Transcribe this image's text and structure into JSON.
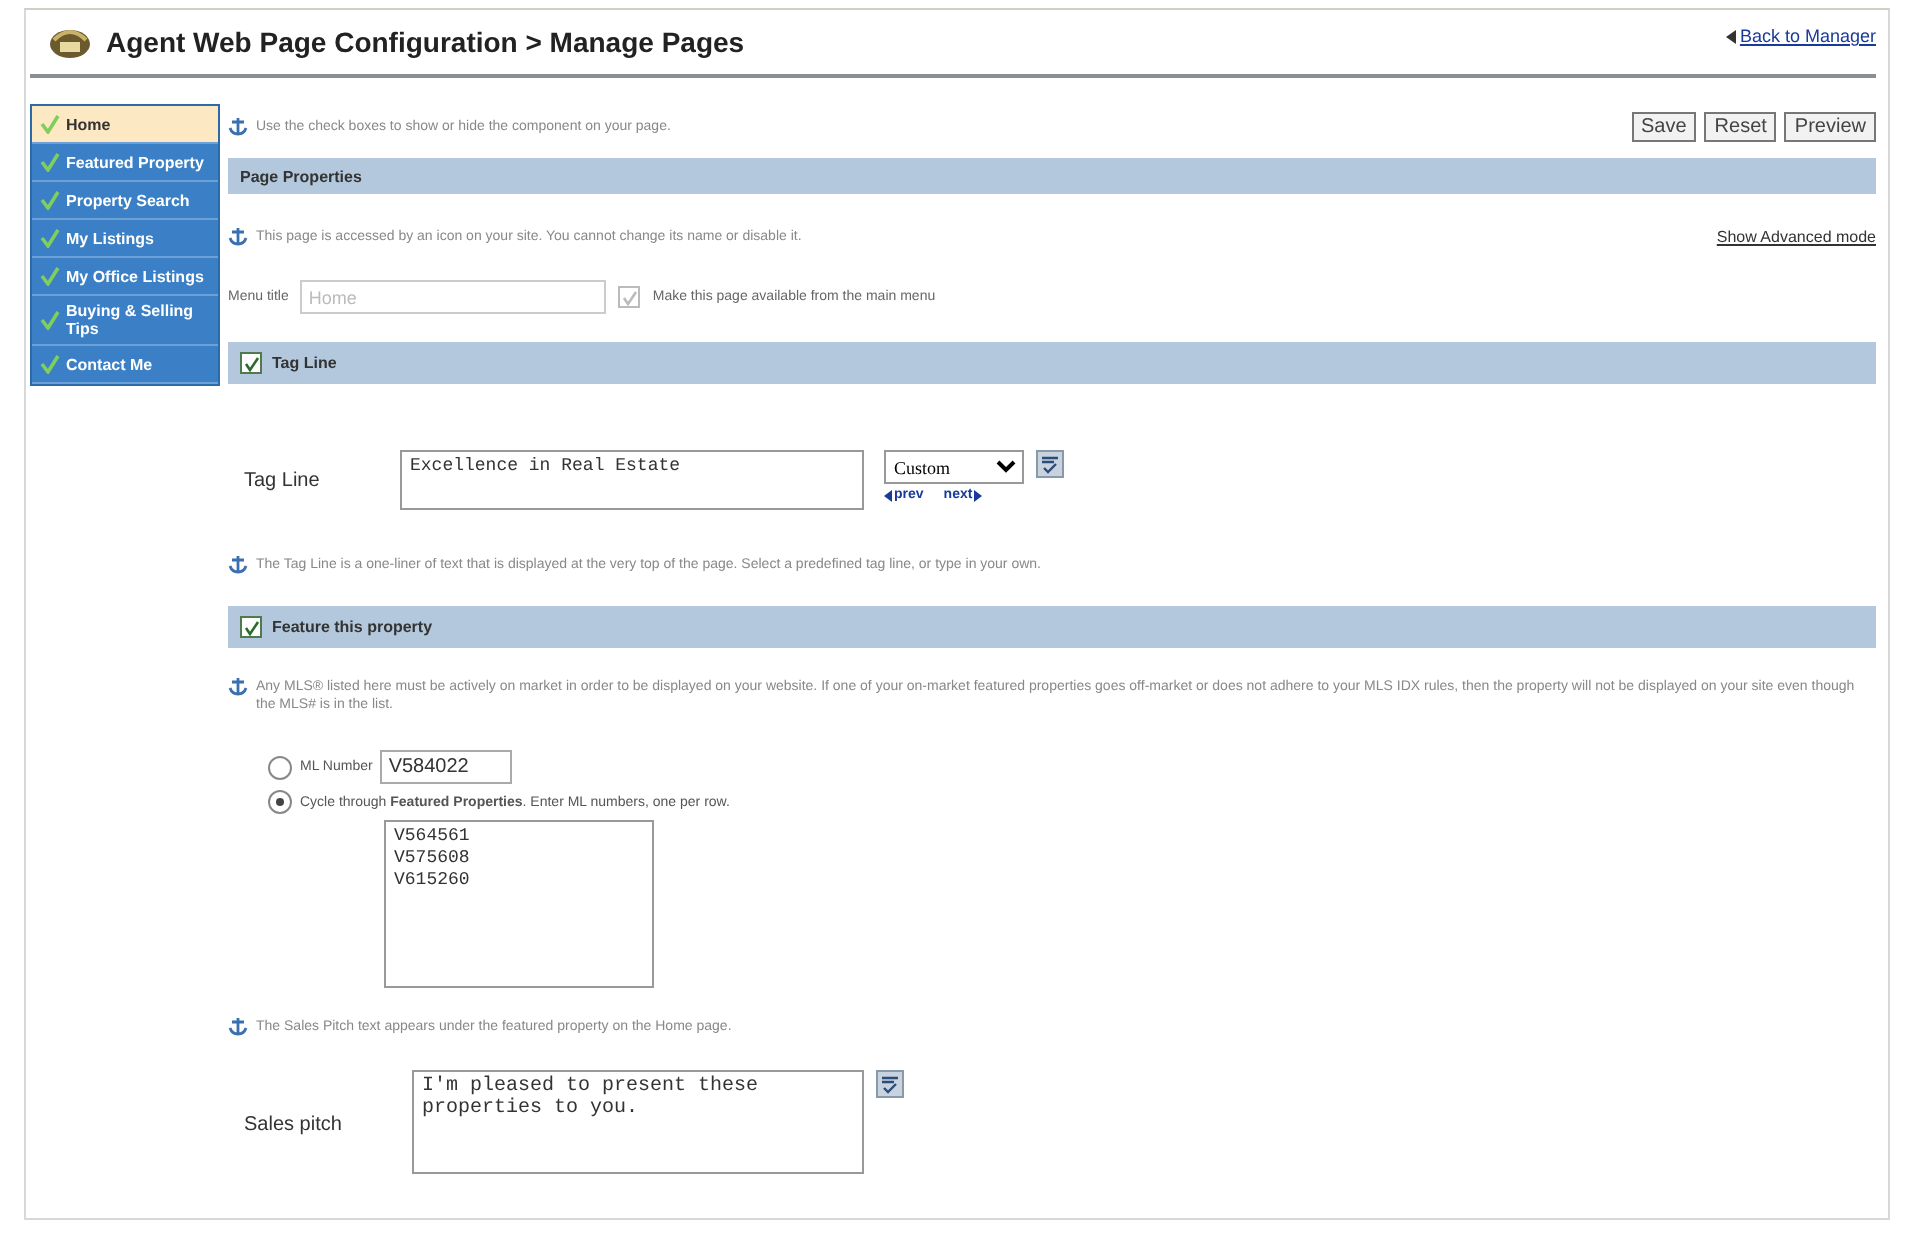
{
  "header": {
    "title": "Agent Web Page Configuration > Manage Pages",
    "back_link": "Back to Manager"
  },
  "sidebar": {
    "items": [
      {
        "label": "Home",
        "selected": true
      },
      {
        "label": "Featured Property",
        "selected": false
      },
      {
        "label": "Property Search",
        "selected": false
      },
      {
        "label": "My Listings",
        "selected": false
      },
      {
        "label": "My Office Listings",
        "selected": false
      },
      {
        "label": "Buying & Selling Tips",
        "selected": false
      },
      {
        "label": "Contact Me",
        "selected": false
      }
    ]
  },
  "intro_help": "Use the check boxes to show or hide the component on your page.",
  "buttons": [
    "Save",
    "Reset",
    "Preview"
  ],
  "page_properties": {
    "title": "Page Properties",
    "help": "This page is accessed by an icon on your site. You cannot change its name or disable it.",
    "advanced_link": "Show Advanced mode",
    "menu_title_label": "Menu title",
    "menu_title_value": "Home",
    "menu_title_disabled": true,
    "main_menu_label": "Make this page available from the main menu",
    "main_menu_checked": true,
    "main_menu_disabled": true
  },
  "tag_line": {
    "title": "Tag Line",
    "checked": true,
    "label": "Tag Line",
    "value": "Excellence in Real Estate",
    "preset": "Custom",
    "prev": "prev",
    "next": "next",
    "help": "The Tag Line is a one-liner of text that is displayed at the very top of the page. Select a predefined tag line, or type in your own."
  },
  "feature": {
    "title": "Feature this property",
    "checked": true,
    "help": "Any MLS® listed here must be actively on market in order to be displayed on your website. If one of your on-market featured properties goes off-market or does not adhere to your MLS IDX rules, then the property will not be displayed on your site even though the MLS# is in the list.",
    "options": [
      {
        "kind": "single",
        "label": "ML Number",
        "selected": false,
        "value": "V584022"
      },
      {
        "kind": "list",
        "label": "Cycle through **Featured Properties**. Enter ML numbers, one per row.",
        "selected": true,
        "values": [
          "V564561",
          "V575608",
          "V615260"
        ]
      }
    ],
    "sales_help": "The Sales Pitch text appears under the featured property on the Home page.",
    "sales_label": "Sales pitch",
    "sales_value": "I'm pleased to present these properties to you."
  }
}
